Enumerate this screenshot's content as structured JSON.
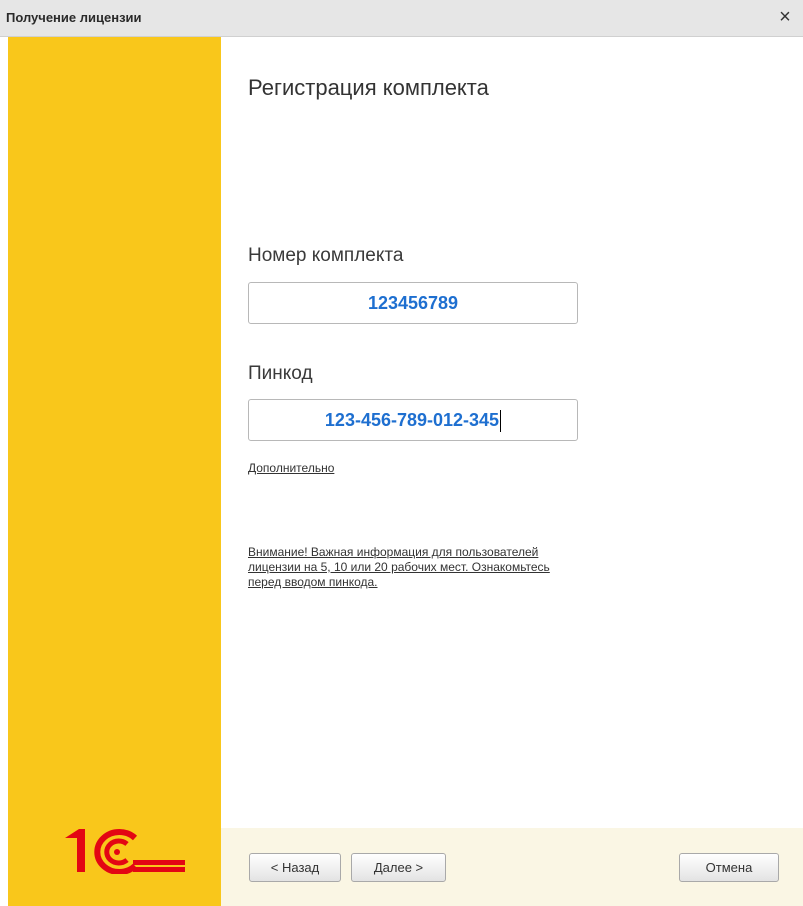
{
  "window": {
    "title": "Получение лицензии",
    "close_glyph": "×"
  },
  "brand": {
    "logo_icon": "1c-logo-icon",
    "color": "#f9c71b",
    "logo_color": "#e30613"
  },
  "form": {
    "heading": "Регистрация комплекта",
    "set_number_label": "Номер комплекта",
    "set_number_value": "123456789",
    "pincode_label": "Пинкод",
    "pincode_value": "123-456-789-012-345",
    "advanced_link": "Дополнительно",
    "warning_lines": [
      "Внимание! Важная информация для пользователей",
      "лицензии на 5, 10 или 20 рабочих мест. Ознакомьтесь",
      "перед вводом пинкода."
    ]
  },
  "buttons": {
    "back": "< Назад",
    "next": "Далее >",
    "cancel": "Отмена"
  }
}
